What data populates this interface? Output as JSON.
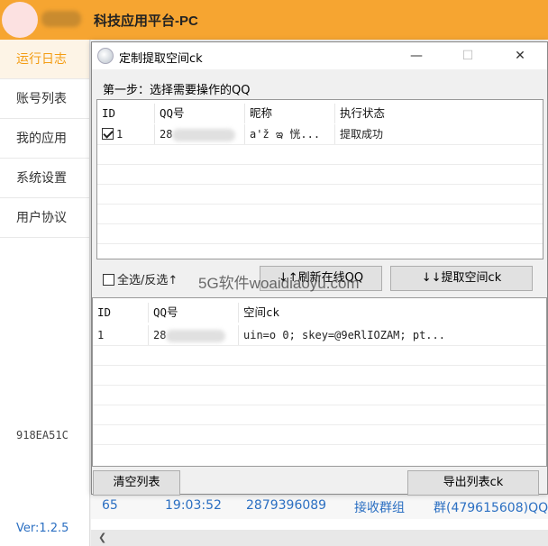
{
  "app": {
    "title": "科技应用平台-PC",
    "sidebar": [
      "运行日志",
      "账号列表",
      "我的应用",
      "系统设置",
      "用户协议"
    ],
    "machine_code": "918EA51C",
    "version": "Ver:1.2.5",
    "log_row": [
      "65",
      "19:03:52",
      "2879396089",
      "接收群组",
      "群(479615608)QQ"
    ]
  },
  "dialog": {
    "title": "定制提取空间ck",
    "minimize": "—",
    "maximize": "☐",
    "close": "✕",
    "step_label": "第一步：选择需要操作的QQ",
    "top_table": {
      "headers": [
        "ID",
        "QQ号",
        "昵称",
        "执行状态"
      ],
      "rows": [
        {
          "id": "1",
          "checked": true,
          "qq": "28",
          "nick": "a'ž ఇ 恍...",
          "status": "提取成功"
        }
      ]
    },
    "select_all_label": "全选/反选↑",
    "refresh_button": "↓↑刷新在线QQ",
    "extract_button": "↓↓提取空间ck",
    "bottom_table": {
      "headers": [
        "ID",
        "QQ号",
        "空间ck"
      ],
      "rows": [
        {
          "id": "1",
          "qq": "28",
          "ck": "uin=o          0; skey=@9eRlIOZAM; pt..."
        }
      ]
    },
    "clear_button": "清空列表",
    "export_button": "导出列表ck",
    "watermark": "5G软件woaidiaoyu.com"
  }
}
